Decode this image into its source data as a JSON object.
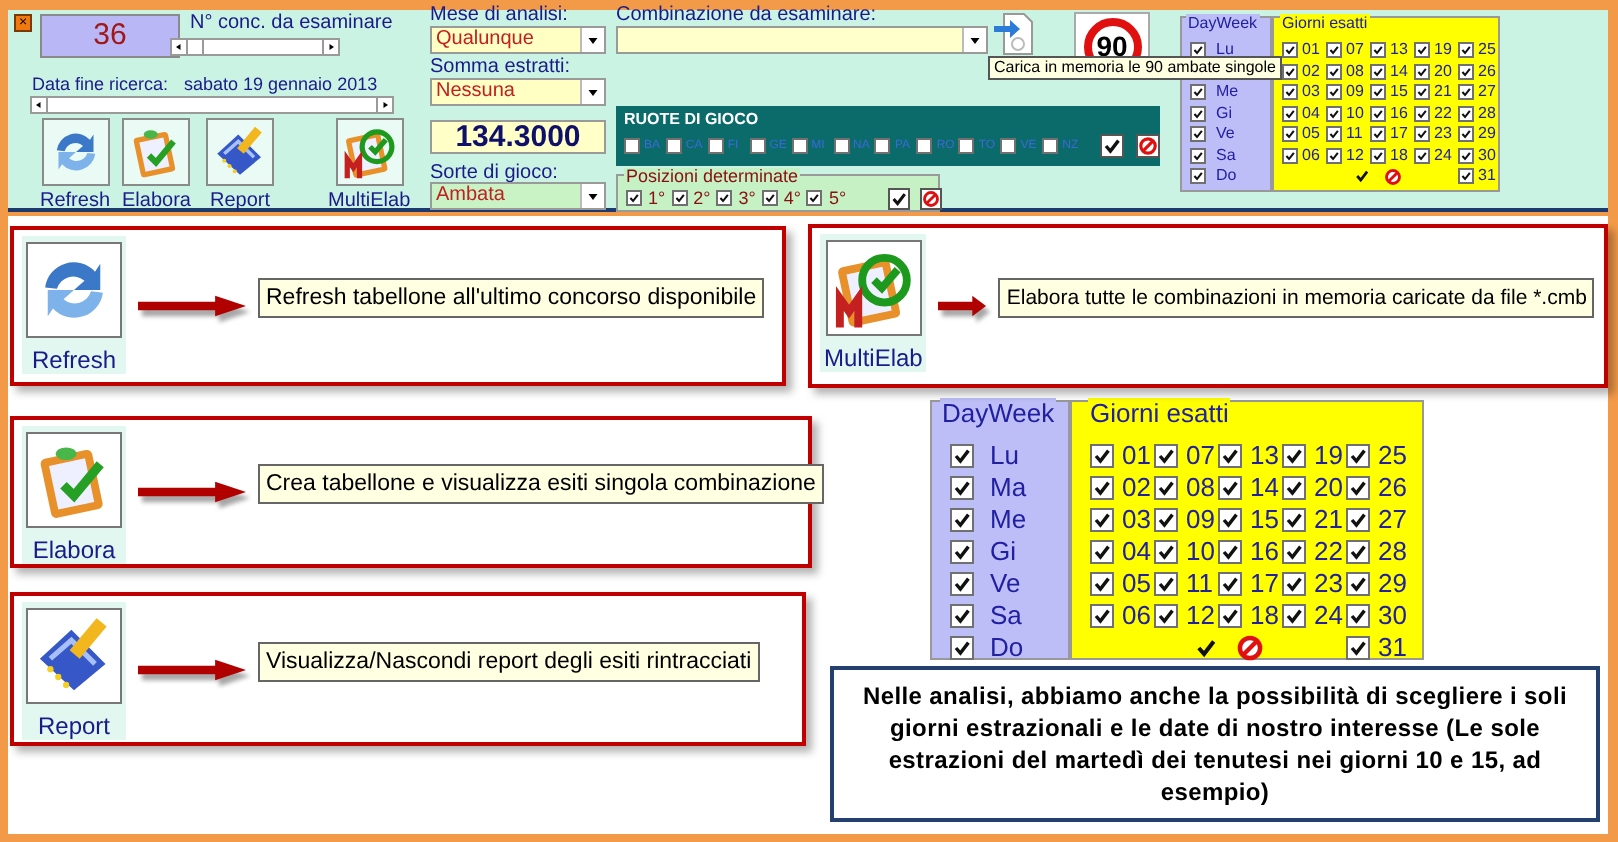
{
  "window": {
    "close": "×"
  },
  "counter": {
    "value": "36",
    "label": "N° conc. da esaminare"
  },
  "end_date": {
    "label": "Data fine ricerca:",
    "value": "sabato 19 gennaio 2013"
  },
  "toolbar": [
    {
      "kind": "refresh",
      "label": "Refresh"
    },
    {
      "kind": "elabora",
      "label": "Elabora"
    },
    {
      "kind": "report",
      "label": "Report"
    },
    {
      "kind": "multielab",
      "label": "MultiElab"
    }
  ],
  "month": {
    "label": "Mese di analisi:",
    "value": "Qualunque"
  },
  "sum": {
    "label": "Somma estratti:",
    "value": "Nessuna"
  },
  "score": "134.3000",
  "game": {
    "label": "Sorte di gioco:",
    "value": "Ambata"
  },
  "combination": {
    "label": "Combinazione da esaminare:"
  },
  "load_tooltip": "Carica in memoria le 90 ambate singole",
  "sign": "90",
  "wheels": {
    "title": "RUOTE DI GIOCO",
    "items": [
      {
        "label": "BA",
        "checked": false
      },
      {
        "label": "CA",
        "checked": false
      },
      {
        "label": "FI",
        "checked": false
      },
      {
        "label": "GE",
        "checked": false
      },
      {
        "label": "MI",
        "checked": false
      },
      {
        "label": "NA",
        "checked": false
      },
      {
        "label": "PA",
        "checked": false
      },
      {
        "label": "RO",
        "checked": false
      },
      {
        "label": "TO",
        "checked": false
      },
      {
        "label": "VE",
        "checked": false
      },
      {
        "label": "NZ",
        "checked": false
      }
    ]
  },
  "positions": {
    "title": "Posizioni determinate",
    "items": [
      {
        "label": "1°",
        "checked": true
      },
      {
        "label": "2°",
        "checked": true
      },
      {
        "label": "3°",
        "checked": true
      },
      {
        "label": "4°",
        "checked": true
      },
      {
        "label": "5°",
        "checked": true
      }
    ]
  },
  "day_filters": [
    {
      "days_title": "DayWeek",
      "days": [
        {
          "label": "Lu",
          "checked": true
        },
        {
          "label": "Me",
          "checked": true
        },
        {
          "label": "Gi",
          "checked": true
        },
        {
          "label": "Ve",
          "checked": true
        },
        {
          "label": "Sa",
          "checked": true
        },
        {
          "label": "Do",
          "checked": true
        }
      ],
      "dates_title": "Giorni esatti",
      "dates": [
        {
          "label": "01",
          "checked": true
        },
        {
          "label": "02",
          "checked": true
        },
        {
          "label": "03",
          "checked": true
        },
        {
          "label": "04",
          "checked": true
        },
        {
          "label": "05",
          "checked": true
        },
        {
          "label": "06",
          "checked": true
        },
        {
          "label": "07",
          "checked": true
        },
        {
          "label": "08",
          "checked": true
        },
        {
          "label": "09",
          "checked": true
        },
        {
          "label": "10",
          "checked": true
        },
        {
          "label": "11",
          "checked": true
        },
        {
          "label": "12",
          "checked": true
        },
        {
          "label": "13",
          "checked": true
        },
        {
          "label": "14",
          "checked": true
        },
        {
          "label": "15",
          "checked": true
        },
        {
          "label": "16",
          "checked": true
        },
        {
          "label": "17",
          "checked": true
        },
        {
          "label": "18",
          "checked": true
        },
        {
          "label": "19",
          "checked": true
        },
        {
          "label": "20",
          "checked": true
        },
        {
          "label": "21",
          "checked": true
        },
        {
          "label": "22",
          "checked": true
        },
        {
          "label": "23",
          "checked": true
        },
        {
          "label": "24",
          "checked": true
        },
        {
          "label": "25",
          "checked": true
        },
        {
          "label": "26",
          "checked": true
        },
        {
          "label": "27",
          "checked": true
        },
        {
          "label": "28",
          "checked": true
        },
        {
          "label": "29",
          "checked": true
        },
        {
          "label": "30",
          "checked": true
        },
        {
          "label": "31",
          "checked": true
        }
      ]
    },
    {
      "days_title": "DayWeek",
      "days": [
        {
          "label": "Lu",
          "checked": true
        },
        {
          "label": "Ma",
          "checked": true
        },
        {
          "label": "Me",
          "checked": true
        },
        {
          "label": "Gi",
          "checked": true
        },
        {
          "label": "Ve",
          "checked": true
        },
        {
          "label": "Sa",
          "checked": true
        },
        {
          "label": "Do",
          "checked": true
        }
      ],
      "dates_title": "Giorni esatti",
      "dates": [
        {
          "label": "01",
          "checked": true
        },
        {
          "label": "02",
          "checked": true
        },
        {
          "label": "03",
          "checked": true
        },
        {
          "label": "04",
          "checked": true
        },
        {
          "label": "05",
          "checked": true
        },
        {
          "label": "06",
          "checked": true
        },
        {
          "label": "07",
          "checked": true
        },
        {
          "label": "08",
          "checked": true
        },
        {
          "label": "09",
          "checked": true
        },
        {
          "label": "10",
          "checked": true
        },
        {
          "label": "11",
          "checked": true
        },
        {
          "label": "12",
          "checked": true
        },
        {
          "label": "13",
          "checked": true
        },
        {
          "label": "14",
          "checked": true
        },
        {
          "label": "15",
          "checked": true
        },
        {
          "label": "16",
          "checked": true
        },
        {
          "label": "17",
          "checked": true
        },
        {
          "label": "18",
          "checked": true
        },
        {
          "label": "19",
          "checked": true
        },
        {
          "label": "20",
          "checked": true
        },
        {
          "label": "21",
          "checked": true
        },
        {
          "label": "22",
          "checked": true
        },
        {
          "label": "23",
          "checked": true
        },
        {
          "label": "24",
          "checked": true
        },
        {
          "label": "25",
          "checked": true
        },
        {
          "label": "26",
          "checked": true
        },
        {
          "label": "27",
          "checked": true
        },
        {
          "label": "28",
          "checked": true
        },
        {
          "label": "29",
          "checked": true
        },
        {
          "label": "30",
          "checked": true
        },
        {
          "label": "31",
          "checked": true
        }
      ]
    }
  ],
  "callouts": [
    {
      "kind": "refresh",
      "label": "Refresh",
      "text": "Refresh tabellone all'ultimo concorso disponibile"
    },
    {
      "kind": "multielab",
      "label": "MultiElab",
      "text": "Elabora tutte le combinazioni in memoria caricate da file *.cmb"
    },
    {
      "kind": "elabora",
      "label": "Elabora",
      "text": "Crea tabellone e visualizza esiti singola combinazione"
    },
    {
      "kind": "report",
      "label": "Report",
      "text": "Visualizza/Nascondi report degli esiti rintracciati"
    }
  ],
  "note": "Nelle analisi, abbiamo anche la possibilità di scegliere i soli giorni estrazionali e le date di nostro interesse (Le sole estrazioni del martedì dei tenutesi nei giorni 10 e 15, ad esempio)"
}
